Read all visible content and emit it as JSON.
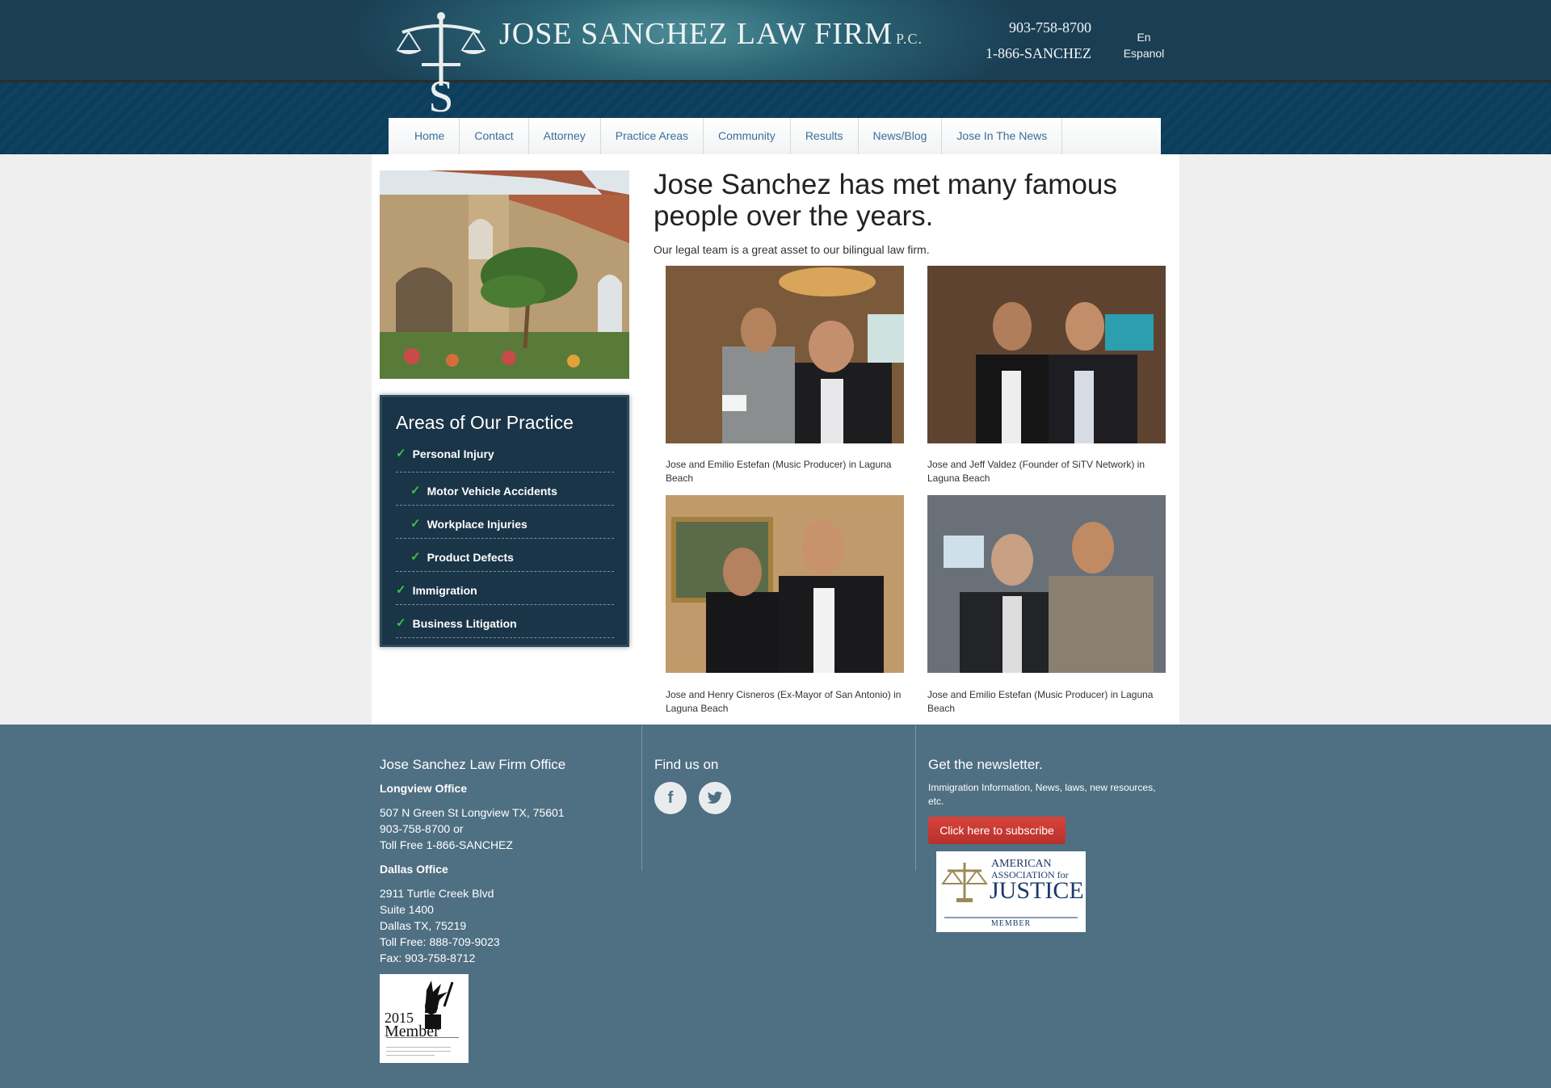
{
  "header": {
    "firm_name": "JOSE SANCHEZ LAW FIRM",
    "firm_suffix": "P.C.",
    "phone_local": "903-758-8700",
    "phone_tollfree": "1-866-SANCHEZ",
    "lang_en": "En",
    "lang_es": "Espanol"
  },
  "nav": {
    "items": [
      "Home",
      "Contact",
      "Attorney",
      "Practice Areas",
      "Community",
      "Results",
      "News/Blog",
      "Jose In The News"
    ]
  },
  "sidebar": {
    "areas_title": "Areas of Our Practice",
    "areas": [
      {
        "label": "Personal Injury",
        "level": "top"
      },
      {
        "label": "Motor Vehicle Accidents",
        "level": "sub"
      },
      {
        "label": "Workplace Injuries",
        "level": "sub"
      },
      {
        "label": "Product Defects",
        "level": "sub"
      },
      {
        "label": "Immigration",
        "level": "top"
      },
      {
        "label": "Business Litigation",
        "level": "top"
      }
    ]
  },
  "main": {
    "title": "Jose Sanchez has met many famous people over the years.",
    "intro": "Our legal team is a great asset to our bilingual law firm.",
    "photos": [
      {
        "caption": "Jose and Emilio Estefan (Music Producer) in Laguna Beach"
      },
      {
        "caption": "Jose and Jeff Valdez (Founder of SiTV Network) in Laguna Beach"
      },
      {
        "caption": "Jose and Henry Cisneros (Ex-Mayor of San Antonio) in Laguna Beach"
      },
      {
        "caption": "Jose and Emilio Estefan (Music Producer) in Laguna Beach"
      }
    ]
  },
  "footer": {
    "office_title": "Jose Sanchez Law Firm Office",
    "longview_title": "Longview Office",
    "longview_address": "507 N Green St Longview TX, 75601",
    "longview_phone": "903-758-8700 or",
    "longview_tollfree": "Toll Free 1-866-SANCHEZ",
    "dallas_title": "Dallas Office",
    "dallas_line1": "2911 Turtle Creek Blvd",
    "dallas_line2": "Suite 1400",
    "dallas_line3": "Dallas TX, 75219",
    "dallas_tollfree": "Toll Free: 888-709-9023",
    "dallas_fax": "Fax: 903-758-8712",
    "find_us_title": "Find us on",
    "newsletter_title": "Get the newsletter.",
    "newsletter_text": "Immigration Information, News, laws, new resources, etc.",
    "subscribe_label": "Click here to subscribe",
    "aaj_line1": "AMERICAN",
    "aaj_line2": "ASSOCIATION for",
    "aaj_line3": "JUSTICE",
    "aaj_line4": "MEMBER",
    "member_year": "2015",
    "member_label": "Member"
  },
  "colors": {
    "footer_bg": "#4f6f82",
    "nav_link": "#3b6e9a",
    "check": "#37c447",
    "subscribe": "#c83a33",
    "areas_bg": "#1a3448"
  }
}
